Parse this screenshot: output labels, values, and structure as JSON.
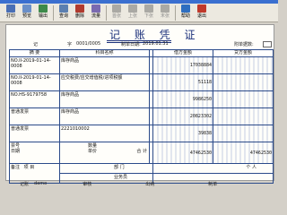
{
  "toolbar": {
    "buttons": [
      {
        "label": "打印",
        "icon": "printer-icon",
        "color": "#4a6fb5",
        "enabled": true
      },
      {
        "label": "预览",
        "icon": "preview-icon",
        "color": "#6a8fc8",
        "enabled": true
      },
      {
        "label": "输出",
        "icon": "export-icon",
        "color": "#3d8a4a",
        "enabled": true
      },
      {
        "label": "查询",
        "icon": "search-icon",
        "color": "#5b7fb0",
        "enabled": true
      },
      {
        "label": "删除",
        "icon": "delete-icon",
        "color": "#b03a2e",
        "enabled": true
      },
      {
        "label": "流量",
        "icon": "flow-icon",
        "color": "#7a6ab0",
        "enabled": true
      },
      {
        "label": "首张",
        "icon": "first-icon",
        "color": "#5a5a5a",
        "enabled": false
      },
      {
        "label": "上张",
        "icon": "prev-icon",
        "color": "#5a5a5a",
        "enabled": false
      },
      {
        "label": "下张",
        "icon": "next-icon",
        "color": "#5a5a5a",
        "enabled": false
      },
      {
        "label": "末张",
        "icon": "last-icon",
        "color": "#5a5a5a",
        "enabled": false
      },
      {
        "label": "帮助",
        "icon": "help-icon",
        "color": "#2e6ec0",
        "enabled": true
      },
      {
        "label": "退出",
        "icon": "exit-icon",
        "color": "#c0392b",
        "enabled": true
      }
    ]
  },
  "voucher": {
    "title": "记 账 凭 证",
    "word_label": "记",
    "word_no_label": "字",
    "voucher_no": "0001/0005",
    "date_label": "制单日期:",
    "date": "2019.01.31",
    "attach_label": "附单据数:",
    "headers": {
      "summary": "摘  要",
      "account": "科目名称",
      "debit": "借方金额",
      "credit": "贷方金额"
    },
    "rows": [
      {
        "summary": "NO.II-2019-01-14-0008",
        "account": "库存商品",
        "debit": "17038884",
        "credit": ""
      },
      {
        "summary": "NO.II-2019-01-14-0008",
        "account": "应交税费/应交增值税/进项税额",
        "debit": "51118",
        "credit": ""
      },
      {
        "summary": "NO.HS-9179758",
        "account": "库存商品",
        "debit": "9986250",
        "credit": ""
      },
      {
        "summary": "普通发票",
        "account": "库存商品",
        "debit": "20823302",
        "credit": ""
      },
      {
        "summary": "普通发票",
        "account": "2221010002",
        "debit": "39838",
        "credit": ""
      }
    ],
    "total": {
      "ticket_label": "票号",
      "date_label": "日期",
      "qty_label": "数量",
      "price_label": "单价",
      "total_label": "合 计",
      "debit": "47462530",
      "credit": "47462530"
    },
    "footer": {
      "note_label": "备注",
      "project_label": "项 目",
      "customer_label": "客 户",
      "department_label": "部 门",
      "salesperson_label": "业务员",
      "individual_label": "个 人"
    }
  },
  "signatures": {
    "bookkeeping_label": "记账",
    "bookkeeping": "demo",
    "audit_label": "审核",
    "cashier_label": "出纳",
    "maker_label": "制单"
  }
}
